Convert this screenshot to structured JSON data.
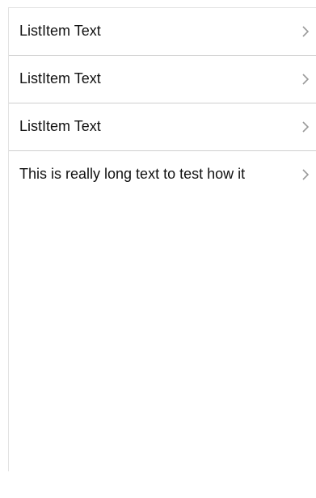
{
  "list": {
    "items": [
      {
        "label": "ListItem Text",
        "icon": "chevron-right-icon"
      },
      {
        "label": "ListItem Text",
        "icon": "chevron-right-icon"
      },
      {
        "label": "ListItem Text",
        "icon": "chevron-right-icon"
      },
      {
        "label": "This is really long text to test how it",
        "icon": "chevron-right-icon"
      }
    ]
  },
  "colors": {
    "text": "#111111",
    "divider": "#cfcfcf",
    "chevron": "#9a9a9a",
    "background": "#ffffff"
  }
}
